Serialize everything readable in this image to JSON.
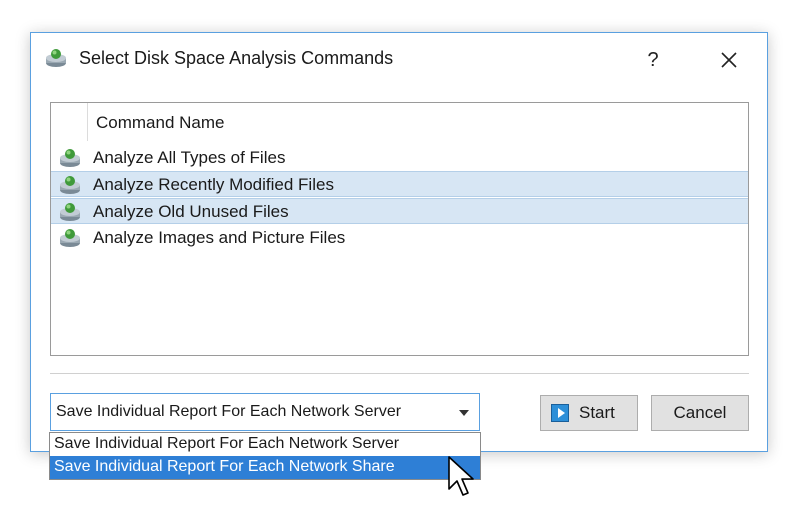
{
  "window": {
    "title": "Select Disk Space Analysis Commands",
    "help_label": "?",
    "close_icon": "close-icon"
  },
  "list": {
    "column_header": "Command Name",
    "rows": [
      {
        "label": "Analyze All Types of Files",
        "selected": false,
        "icon": "disk-analysis-icon"
      },
      {
        "label": "Analyze Recently Modified Files",
        "selected": true,
        "icon": "disk-analysis-icon"
      },
      {
        "label": "Analyze Old Unused Files",
        "selected": true,
        "icon": "disk-analysis-icon"
      },
      {
        "label": "Analyze Images and Picture Files",
        "selected": false,
        "icon": "disk-analysis-icon"
      }
    ]
  },
  "report_mode": {
    "selected_value": "Save Individual Report For Each Network Server",
    "options": [
      "Save Individual Report For Each Network Server",
      "Save Individual Report For Each Network Share"
    ],
    "highlighted_option": "Save Individual Report For Each Network Share"
  },
  "buttons": {
    "start_label": "Start",
    "cancel_label": "Cancel"
  },
  "colors": {
    "accent": "#2e7fd6",
    "selection": "#d7e6f4",
    "dialog_border": "#5aa0e0"
  }
}
